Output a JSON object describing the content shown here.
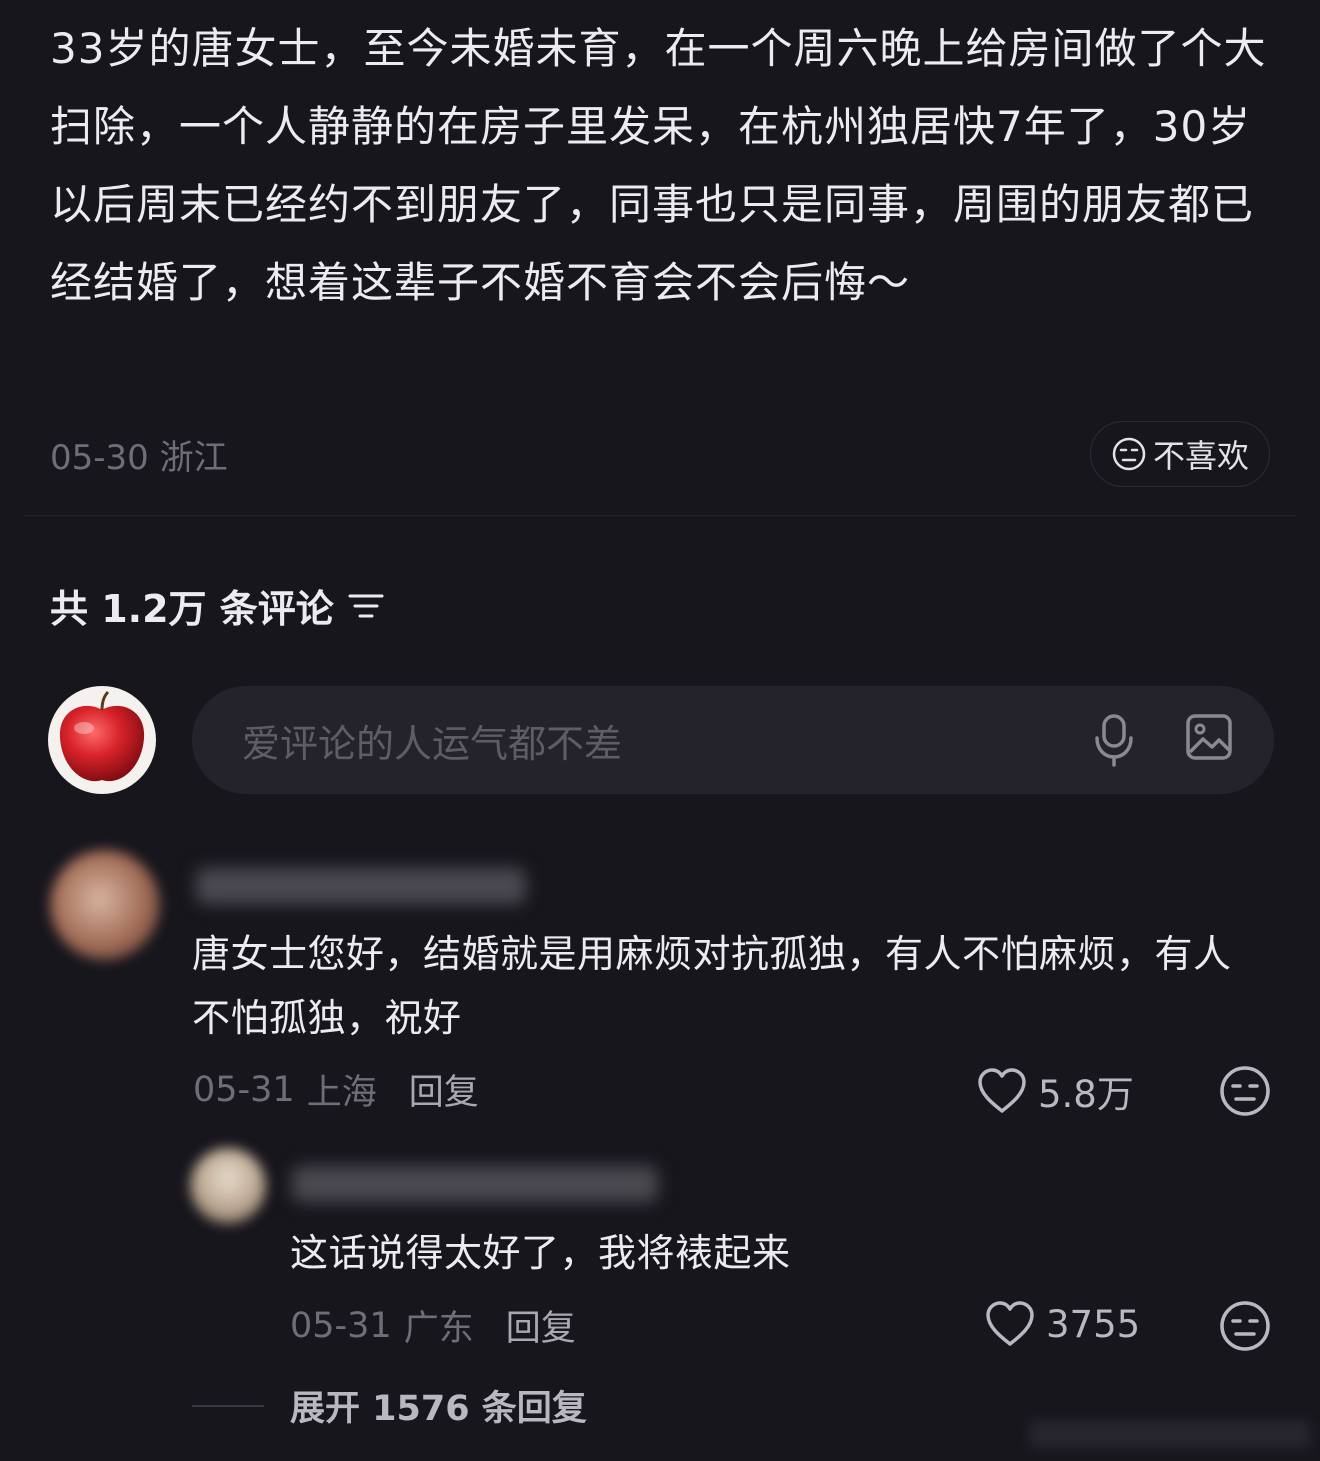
{
  "post": {
    "text": "33岁的唐女士，至今未婚未育，在一个周六晚上给房间做了个大扫除，一个人静静的在房子里发呆，在杭州独居快7年了，30岁以后周末已经约不到朋友了，同事也只是同事，周围的朋友都已经结婚了，想着这辈子不婚不育会不会后悔～",
    "date": "05-30",
    "location": "浙江",
    "dislike_label": "不喜欢"
  },
  "comments_header": {
    "count_label": "共 1.2万 条评论",
    "sort_icon": "sort-lines-icon"
  },
  "composer": {
    "placeholder": "爱评论的人运气都不差",
    "avatar_icon": "apple-avatar",
    "mic_icon": "microphone-icon",
    "image_icon": "image-icon"
  },
  "comments": [
    {
      "text": "唐女士您好，结婚就是用麻烦对抗孤独，有人不怕麻烦，有人不怕孤独，祝好",
      "date": "05-31",
      "location": "上海",
      "reply_label": "回复",
      "likes": "5.8万",
      "replies": [
        {
          "text": "这话说得太好了，我将裱起来",
          "date": "05-31",
          "location": "广东",
          "reply_label": "回复",
          "likes": "3755"
        }
      ],
      "expand_label": "展开 1576 条回复"
    }
  ],
  "colors": {
    "background": "#17161d",
    "text_primary": "#ecebf0",
    "text_muted": "#6f6e78",
    "input_bg": "#24232b"
  }
}
